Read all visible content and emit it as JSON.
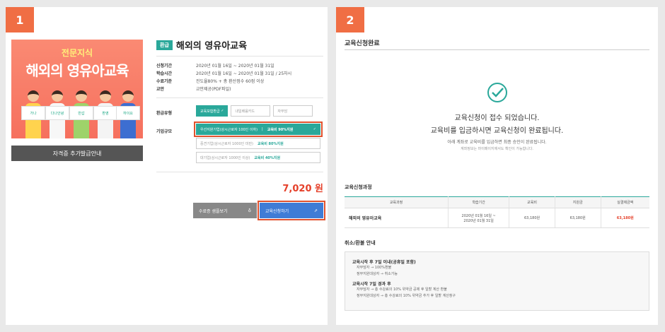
{
  "steps": [
    "1",
    "2"
  ],
  "left": {
    "banner": {
      "top_text": "전문지식",
      "title": "해외의 영유아교육",
      "signs": [
        "가나",
        "다나안녕",
        "반갑",
        "환영",
        "하이요"
      ]
    },
    "banner_button": "자격증 추가발급안내",
    "tag": "환급",
    "product_title": "해외의 영유아교육",
    "specs": [
      {
        "label": "신청기간",
        "value": "2020년 01월 16일 ~ 2020년 01월 31일"
      },
      {
        "label": "학습시간",
        "value": "2020년 01월 16일 ~ 2020년 01월 31일 / 25차시"
      },
      {
        "label": "수료기준",
        "value": "진도율80% + 총 환산점수 60점 이상"
      },
      {
        "label": "교안",
        "value": "교안제공(PDF파일)"
      }
    ],
    "refund_label": "환급유형",
    "refund_options": [
      "교육보험환급",
      "내일배움카드",
      "자부담"
    ],
    "company_label": "기업규모",
    "company_options": [
      {
        "name": "우선지원기업(상시근로자 100인 이하)",
        "pct": "교육비 90%지원"
      },
      {
        "name": "중견기업(상시근로자 1000인 미만)",
        "pct": "교육비 80%지원"
      },
      {
        "name": "대기업(상시근로자 1000인 이상)",
        "pct": "교육비 40%지원"
      }
    ],
    "price": "7,020 원",
    "sample_button": "수료증 샘플보기",
    "apply_button": "교육신청하기"
  },
  "right": {
    "title": "교육신청완료",
    "msg1": "교육신청이 접수 되었습니다.",
    "msg2": "교육비를 입금하시면 교육신청이 완료됩니다.",
    "msg3": "아래 계좌로 교육비를 입금하면 최종 승인이 완료됩니다.",
    "msg4": "계좌정보는 마이페이지에서도 확인이 가능합니다.",
    "process_title": "교육신청과정",
    "table": {
      "headers": [
        "교육과정",
        "학습기간",
        "교육비",
        "지원금",
        "실결제금액"
      ],
      "row": {
        "course": "해외의 영유아교육",
        "period_1": "2020년 01월 16일 ~",
        "period_2": "2020년 01월 31일",
        "fee": "63,180원",
        "support": "63,180원",
        "final": "63,180원"
      }
    },
    "refund_title": "취소/환불 안내",
    "notice": {
      "head1": "교육시작 후 7일 이내(공휴일 포함)",
      "item1": "자부담자 → 100%환불",
      "item2": "정부지원대상자 → 취소가능",
      "head2": "교육시작 7일 경과 후",
      "item3": "자부담자 → 총 수강료의 10% 위약금 공제 후 일할 계산 환불",
      "item4": "정부지원대상자 → 총 수강료의 10% 위약금 추가 후 일할 계산청구"
    }
  },
  "colors": {
    "accent": "#2aa89a",
    "highlight": "#e0522e",
    "price": "#e5402a",
    "apply": "#3f7cd6"
  }
}
